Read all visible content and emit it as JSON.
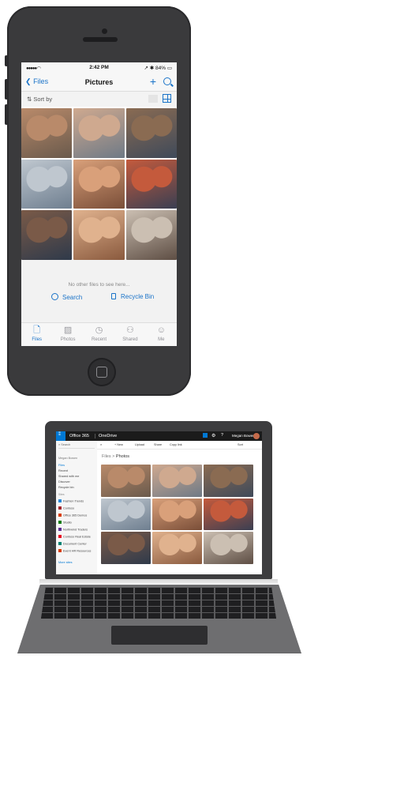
{
  "phone": {
    "status": {
      "time": "2:42 PM",
      "battery": "84%"
    },
    "navbar": {
      "back_label": "Files",
      "title": "Pictures"
    },
    "sort_label": "Sort by",
    "empty_text": "No other files to see here...",
    "search_label": "Search",
    "recycle_label": "Recycle Bin",
    "tabs": [
      {
        "label": "Files",
        "icon": "document-icon"
      },
      {
        "label": "Photos",
        "icon": "photos-icon"
      },
      {
        "label": "Recent",
        "icon": "clock-icon"
      },
      {
        "label": "Shared",
        "icon": "people-icon"
      },
      {
        "label": "Me",
        "icon": "person-icon"
      }
    ],
    "photos": [
      {
        "colors": [
          "#b98a6a",
          "#6a5a4c"
        ]
      },
      {
        "colors": [
          "#cfa98f",
          "#6f7a86"
        ]
      },
      {
        "colors": [
          "#8a6b52",
          "#3f4a5a"
        ]
      },
      {
        "colors": [
          "#bfc7cf",
          "#6f7f90"
        ]
      },
      {
        "colors": [
          "#d9a07a",
          "#7a4e38"
        ]
      },
      {
        "colors": [
          "#c45a3c",
          "#3a3f52"
        ]
      },
      {
        "colors": [
          "#7a5a48",
          "#2f3a4a"
        ]
      },
      {
        "colors": [
          "#e0b28e",
          "#8a5a3e"
        ]
      },
      {
        "colors": [
          "#cbbfb2",
          "#5e4e44"
        ]
      }
    ]
  },
  "laptop": {
    "header": {
      "suite": "Office 365",
      "app": "OneDrive",
      "user": "Megan Bowen"
    },
    "sidebar": {
      "search": "Search",
      "user": "Megan Bowen",
      "items": [
        "Files",
        "Recent",
        "Shared with me",
        "Discover",
        "Recycle bin"
      ],
      "group": "Sites",
      "sites": [
        {
          "name": "Fashion Trends",
          "color": "#2b88d8"
        },
        {
          "name": "Contoso",
          "color": "#a4262c"
        },
        {
          "name": "Office 365 Demos",
          "color": "#d83b01"
        },
        {
          "name": "Studio",
          "color": "#107c10"
        },
        {
          "name": "Northwind Traders",
          "color": "#5c2d91"
        },
        {
          "name": "Contoso Real Estate",
          "color": "#e81123"
        },
        {
          "name": "Document Center",
          "color": "#008272"
        },
        {
          "name": "Event HR Resources",
          "color": "#d83b01"
        }
      ],
      "more": "More sites"
    },
    "commands": [
      "+ New",
      "Upload",
      "Share",
      "Copy link",
      "Sort"
    ],
    "breadcrumb": {
      "root": "Files",
      "current": "Photos"
    },
    "photos": [
      {
        "colors": [
          "#b98a6a",
          "#6a5a4c"
        ]
      },
      {
        "colors": [
          "#cfa98f",
          "#6f7a86"
        ]
      },
      {
        "colors": [
          "#8a6b52",
          "#3f4a5a"
        ]
      },
      {
        "colors": [
          "#bfc7cf",
          "#6f7f90"
        ]
      },
      {
        "colors": [
          "#d9a07a",
          "#7a4e38"
        ]
      },
      {
        "colors": [
          "#c45a3c",
          "#3a3f52"
        ]
      },
      {
        "colors": [
          "#7a5a48",
          "#2f3a4a"
        ]
      },
      {
        "colors": [
          "#e0b28e",
          "#8a5a3e"
        ]
      },
      {
        "colors": [
          "#cbbfb2",
          "#5e4e44"
        ]
      }
    ]
  }
}
